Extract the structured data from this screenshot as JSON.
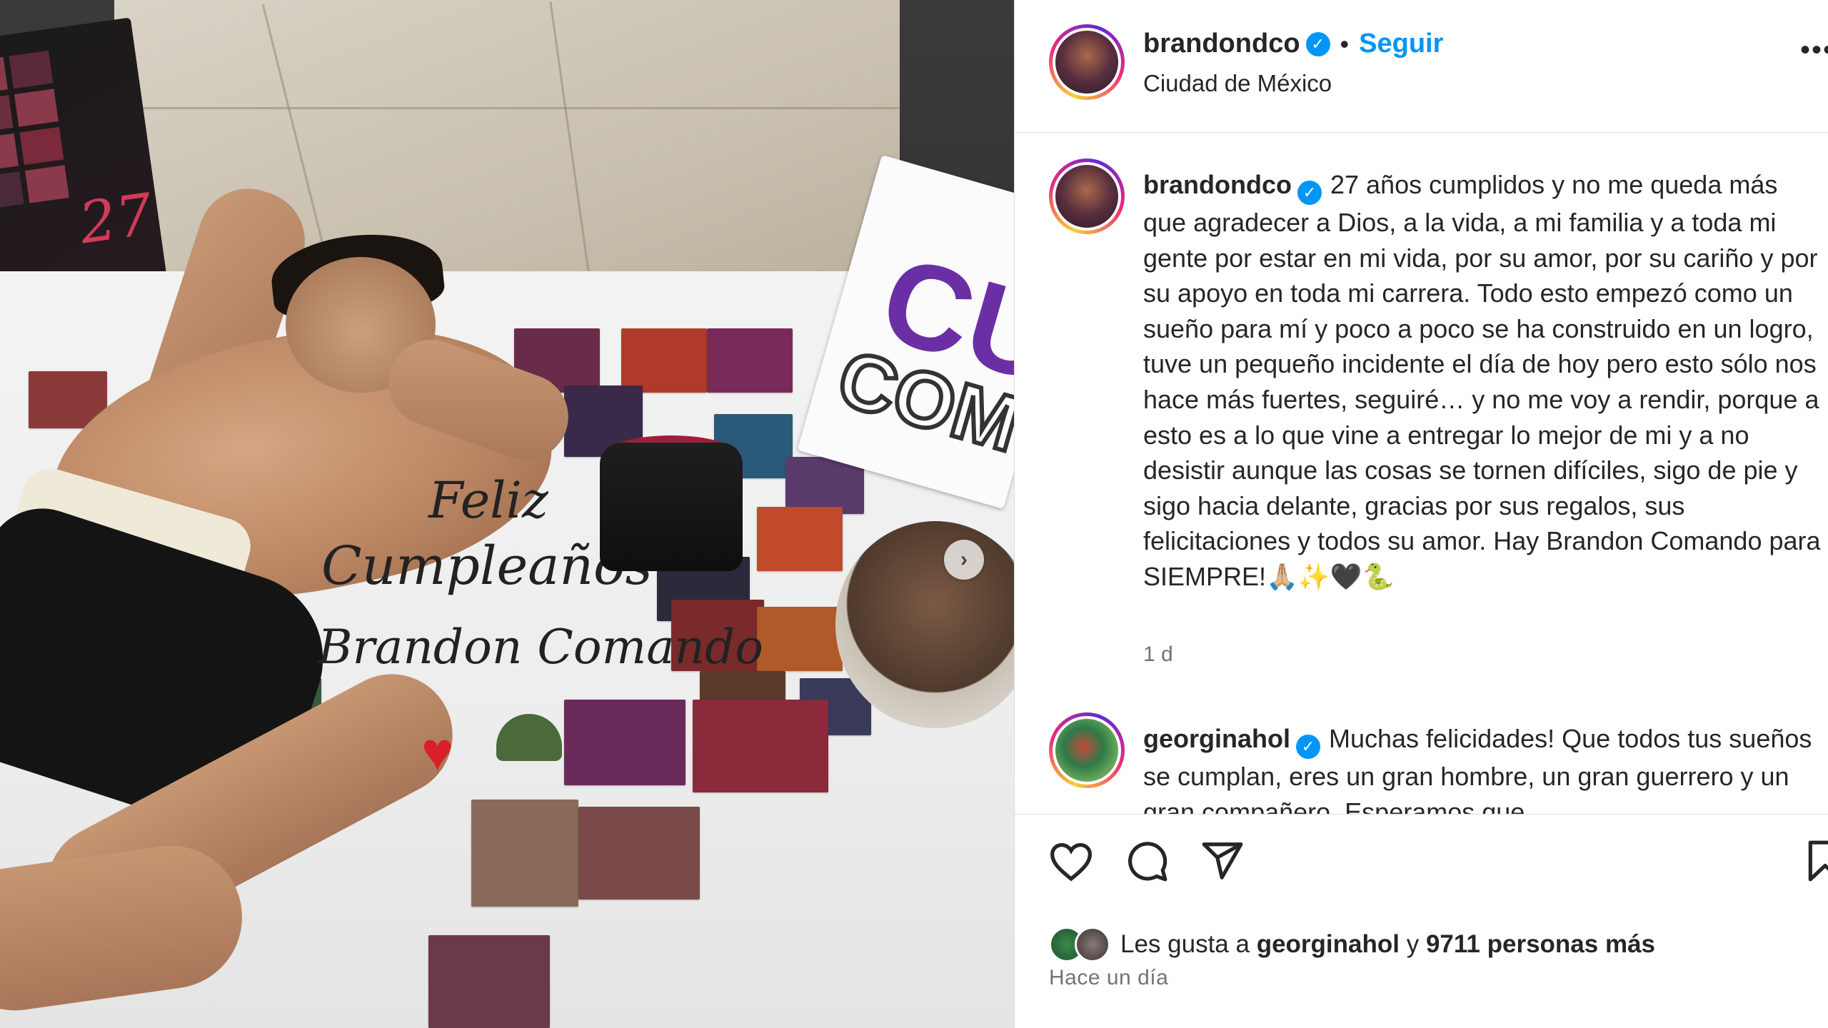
{
  "post": {
    "author": "brandondco",
    "follow_label": "Seguir",
    "separator": "•",
    "location": "Ciudad de México",
    "more_label": "•••"
  },
  "photo": {
    "banner_line1": "Feliz",
    "banner_line2": "Cumpleaños",
    "banner_line3": "Brandon Comando",
    "cake_text": "Feliz Cumpleaños Brandon",
    "poster_number": "27",
    "sign_text1": "CU",
    "sign_text2": "COM",
    "next_label": "›"
  },
  "caption": {
    "username": "brandondco",
    "text": "27 años cumplidos y no me queda más que agradecer a Dios, a la vida, a mi familia y a toda mi gente por estar en mi vida, por su amor, por su cariño y por su apoyo en toda mi carrera. Todo esto empezó como un sueño para mí y poco a poco se ha construido en un logro, tuve un pequeño incidente el día de hoy pero esto sólo nos hace más fuertes, seguiré… y no me voy a rendir, porque a esto es a lo que vine a entregar lo mejor de mi y a no desistir aunque las cosas se tornen difíciles, sigo de pie y sigo hacia delante, gracias por sus regalos, sus felicitaciones y todos su amor. Hay Brandon Comando para SIEMPRE!🙏🏼✨🖤🐍",
    "time": "1 d"
  },
  "comment": {
    "username": "georginahol",
    "text": "Muchas felicidades! Que todos tus sueños se cumplan, eres un gran hombre, un gran guerrero y un gran compañero. Esperamos que"
  },
  "likes": {
    "prefix": "Les gusta a",
    "first_liker": "georginahol",
    "connector": "y",
    "others": "9711 personas más",
    "posted": "Hace un día"
  },
  "icons": [
    "heart-icon",
    "comment-icon",
    "share-icon",
    "bookmark-icon",
    "verified-icon",
    "more-icon"
  ],
  "colors": {
    "accent": "#0095f6",
    "text": "#262626",
    "muted": "#737373",
    "border": "#dbdbdb"
  }
}
